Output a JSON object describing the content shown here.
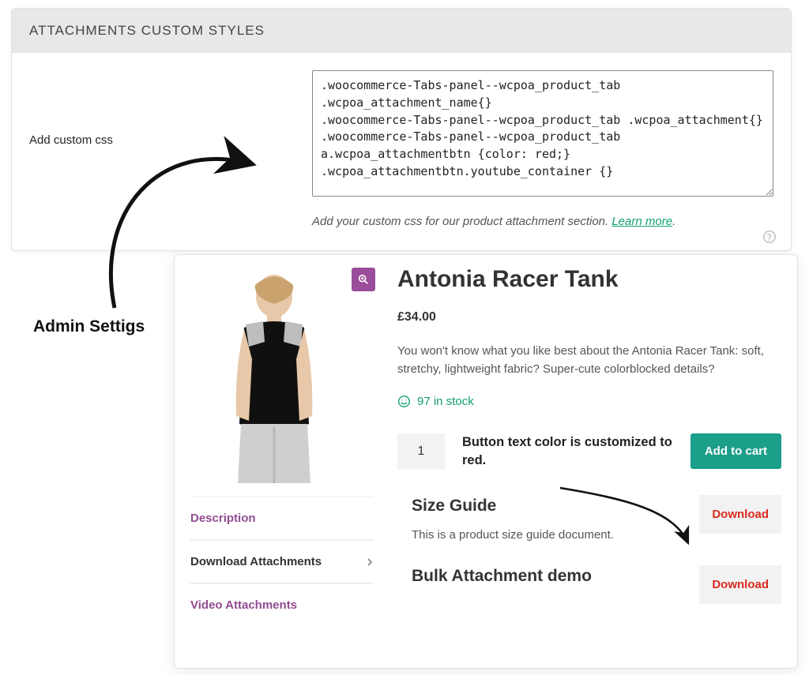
{
  "admin": {
    "header": "ATTACHMENTS CUSTOM STYLES",
    "label": "Add custom css",
    "css_value": ".woocommerce-Tabs-panel--wcpoa_product_tab .wcpoa_attachment_name{}\n.woocommerce-Tabs-panel--wcpoa_product_tab .wcpoa_attachment{}\n.woocommerce-Tabs-panel--wcpoa_product_tab a.wcpoa_attachmentbtn {color: red;}\n.wcpoa_attachmentbtn.youtube_container {}",
    "help_text": "Add your custom css for our product attachment section. ",
    "learn_more": "Learn more"
  },
  "annotation": {
    "label": "Admin Settigs",
    "note": "Button text color is customized to red."
  },
  "product": {
    "title": "Antonia Racer Tank",
    "price": "£34.00",
    "description": "You won't know what you like best about the Antonia Racer Tank: soft, stretchy, lightweight fabric? Super-cute colorblocked details?",
    "stock": "97 in stock",
    "quantity": "1",
    "add_to_cart": "Add to cart"
  },
  "tabs": {
    "description": "Description",
    "downloads": "Download Attachments",
    "videos": "Video Attachments"
  },
  "attachments": {
    "size_guide": {
      "title": "Size Guide",
      "desc": "This is a product size guide document.",
      "btn": "Download"
    },
    "bulk": {
      "title": "Bulk Attachment demo",
      "btn": "Download"
    }
  }
}
